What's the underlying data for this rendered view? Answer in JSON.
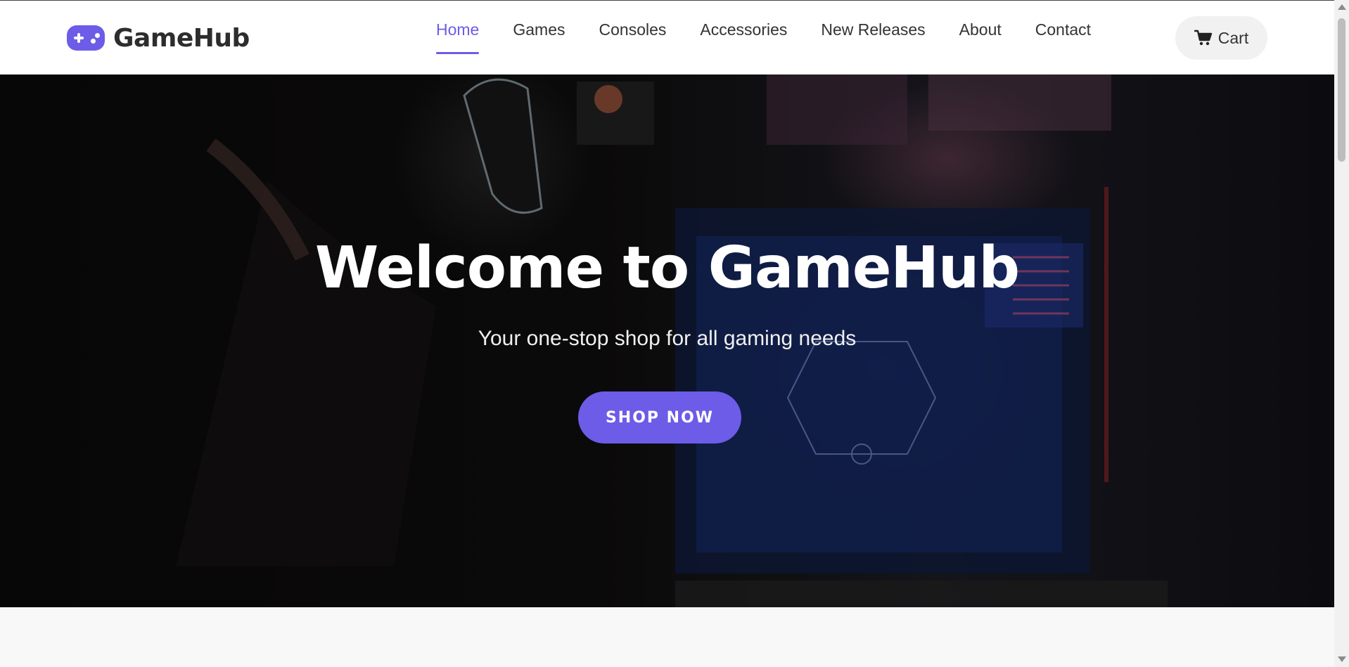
{
  "brand": {
    "name": "GameHub",
    "icon": "gamepad-icon",
    "accent_color": "#6c5ce7"
  },
  "nav": {
    "items": [
      {
        "label": "Home",
        "active": true
      },
      {
        "label": "Games",
        "active": false
      },
      {
        "label": "Consoles",
        "active": false
      },
      {
        "label": "Accessories",
        "active": false
      },
      {
        "label": "New Releases",
        "active": false
      },
      {
        "label": "About",
        "active": false
      },
      {
        "label": "Contact",
        "active": false
      }
    ],
    "cart": {
      "label": "Cart",
      "icon": "cart-icon"
    }
  },
  "hero": {
    "title": "Welcome to GameHub",
    "subtitle": "Your one-stop shop for all gaming needs",
    "cta_label": "SHOP NOW"
  }
}
